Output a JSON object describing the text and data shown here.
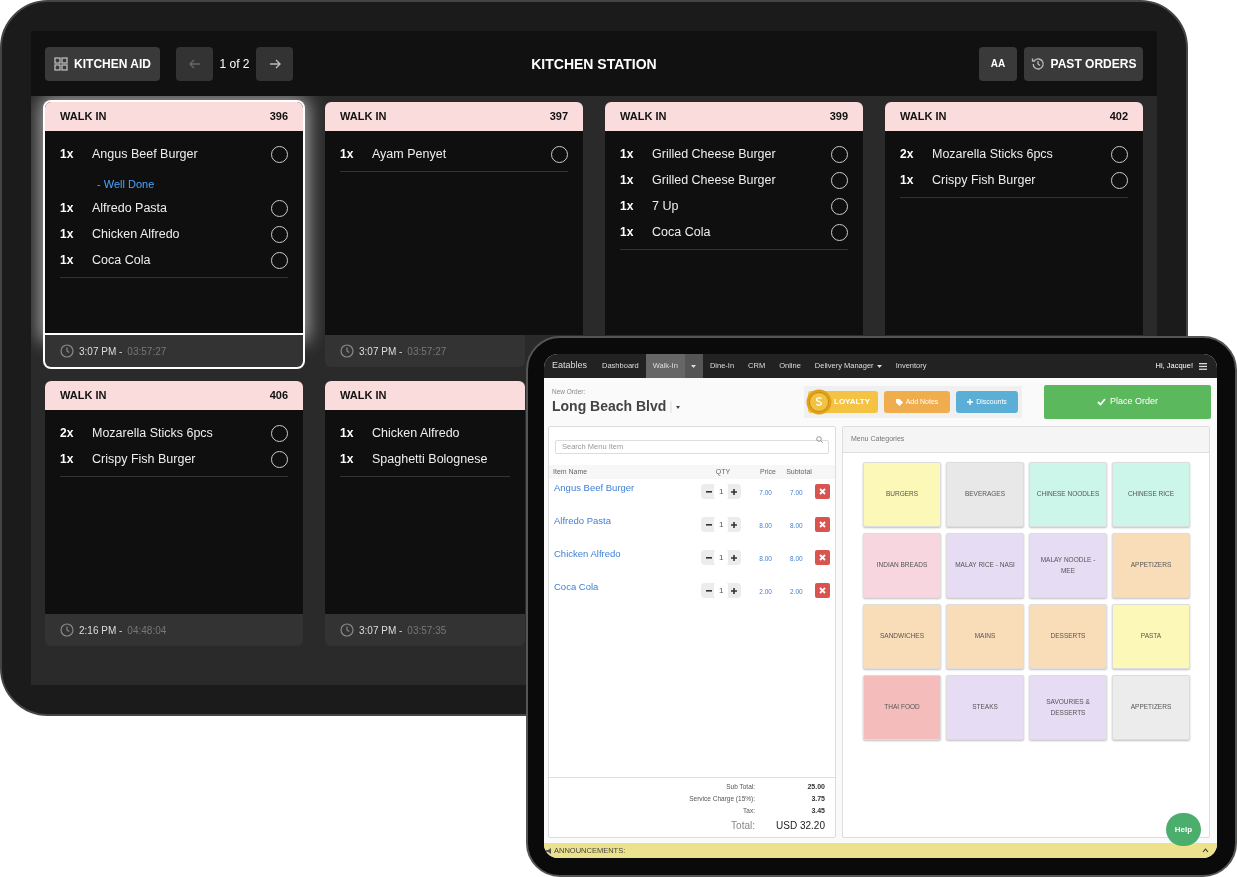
{
  "kitchen_screen": {
    "header": {
      "kitchen_aid_button": "KITCHEN AID",
      "pager": {
        "label": "1 of 2",
        "prev": {
          "disabled": true
        },
        "next": {
          "disabled": false
        }
      },
      "title": "KITCHEN STATION",
      "font_button": "AA",
      "past_orders_button": "PAST ORDERS"
    },
    "orders": [
      {
        "type": "WALK IN",
        "number": "396",
        "selected": true,
        "items": [
          {
            "qty": "1x",
            "name": "Angus Beef Burger",
            "note": "- Well Done",
            "checked": false
          },
          {
            "qty": "1x",
            "name": "Alfredo Pasta",
            "checked": false
          },
          {
            "qty": "1x",
            "name": "Chicken Alfredo",
            "checked": false
          },
          {
            "qty": "1x",
            "name": "Coca Cola",
            "checked": false
          }
        ],
        "time": "3:07 PM -",
        "elapsed": "03:57:27"
      },
      {
        "type": "WALK IN",
        "number": "397",
        "selected": false,
        "items": [
          {
            "qty": "1x",
            "name": "Ayam Penyet",
            "checked": false
          }
        ],
        "time": "3:07 PM -",
        "elapsed": "03:57:27"
      },
      {
        "type": "WALK IN",
        "number": "399",
        "selected": false,
        "items": [
          {
            "qty": "1x",
            "name": "Grilled Cheese Burger",
            "checked": false
          },
          {
            "qty": "1x",
            "name": "Grilled Cheese Burger",
            "checked": false
          },
          {
            "qty": "1x",
            "name": "7 Up",
            "checked": false
          },
          {
            "qty": "1x",
            "name": "Coca Cola",
            "checked": false
          }
        ]
      },
      {
        "type": "WALK IN",
        "number": "402",
        "selected": false,
        "items": [
          {
            "qty": "2x",
            "name": "Mozarella Sticks 6pcs",
            "checked": false
          },
          {
            "qty": "1x",
            "name": "Crispy Fish Burger",
            "checked": false
          }
        ]
      },
      {
        "type": "WALK IN",
        "number": "406",
        "selected": false,
        "items": [
          {
            "qty": "2x",
            "name": "Mozarella Sticks 6pcs",
            "checked": false
          },
          {
            "qty": "1x",
            "name": "Crispy Fish Burger",
            "checked": false
          }
        ],
        "time": "2:16 PM -",
        "elapsed": "04:48:04"
      },
      {
        "type": "WALK IN",
        "selected": false,
        "items": [
          {
            "qty": "1x",
            "name": "Chicken Alfredo"
          },
          {
            "qty": "1x",
            "name": "Spaghetti Bolognese"
          }
        ],
        "time": "3:07 PM -",
        "elapsed": "03:57:35"
      }
    ]
  },
  "pos_screen": {
    "navbar": {
      "brand": "Eatables",
      "items": [
        {
          "label": "Dashboard",
          "kind": "link",
          "selected": false
        },
        {
          "label": "Walk-In",
          "kind": "split",
          "selected": true
        },
        {
          "label": "Dine-In",
          "kind": "link",
          "selected": false
        },
        {
          "label": "CRM",
          "kind": "link",
          "selected": false
        },
        {
          "label": "Online",
          "kind": "link",
          "selected": false
        },
        {
          "label": "Delivery Manager",
          "kind": "dropdown",
          "selected": false
        },
        {
          "label": "Inventory",
          "kind": "link",
          "selected": false
        }
      ],
      "user": "Hi, Jacque!"
    },
    "order": {
      "label": "New Order:",
      "location": "Long Beach Blvd",
      "buttons": [
        {
          "kind": "loyalty",
          "label": "LOYALTY"
        },
        {
          "kind": "notes",
          "label": "Add Notes"
        },
        {
          "kind": "discounts",
          "label": "Discounts"
        }
      ],
      "place_order": "Place Order"
    },
    "cart": {
      "search_placeholder": "Search Menu Item",
      "columns": [
        "Item Name",
        "QTY",
        "Price",
        "Subtotal"
      ],
      "rows": [
        {
          "name": "Angus Beef Burger",
          "qty": "1",
          "price": "7.00",
          "subtotal": "7.00"
        },
        {
          "name": "Alfredo Pasta",
          "qty": "1",
          "price": "8.00",
          "subtotal": "8.00"
        },
        {
          "name": "Chicken Alfredo",
          "qty": "1",
          "price": "8.00",
          "subtotal": "8.00"
        },
        {
          "name": "Coca Cola",
          "qty": "1",
          "price": "2.00",
          "subtotal": "2.00"
        }
      ],
      "totals": [
        {
          "label": "Sub Total:",
          "value": "25.00"
        },
        {
          "label": "Service Charge (15%):",
          "value": "3.75"
        },
        {
          "label": "Tax:",
          "value": "3.45"
        }
      ],
      "total": {
        "label": "Total:",
        "value": "USD 32.20"
      }
    },
    "categories": {
      "title": "Menu Categories",
      "tiles": [
        {
          "label": "BURGERS",
          "color": "#fbf8b8"
        },
        {
          "label": "BEVERAGES",
          "color": "#e8e8e8"
        },
        {
          "label": "CHINESE NOODLES",
          "color": "#cdf6ea"
        },
        {
          "label": "CHINESE RICE",
          "color": "#cdf6ea"
        },
        {
          "label": "INDIAN BREADS",
          "color": "#f8d6e0"
        },
        {
          "label": "MALAY RICE - NASI",
          "color": "#e6dcf3"
        },
        {
          "label": "MALAY NOODLE - MEE",
          "color": "#e6dcf3"
        },
        {
          "label": "APPETIZERS",
          "color": "#f9ddb8"
        },
        {
          "label": "SANDWICHES",
          "color": "#f9ddb8"
        },
        {
          "label": "MAINS",
          "color": "#f9ddb8"
        },
        {
          "label": "DESSERTS",
          "color": "#f9ddb8"
        },
        {
          "label": "PASTA",
          "color": "#fbf8b8"
        },
        {
          "label": "THAI FOOD",
          "color": "#f5bcbc"
        },
        {
          "label": "STEAKS",
          "color": "#e6dcf3"
        },
        {
          "label": "SAVOURIES & DESSERTS",
          "color": "#e6dcf3"
        },
        {
          "label": "APPETIZERS",
          "color": "#ececec"
        }
      ]
    },
    "help_button": "Help",
    "announcements": "ANNOUNCEMENTS:"
  }
}
